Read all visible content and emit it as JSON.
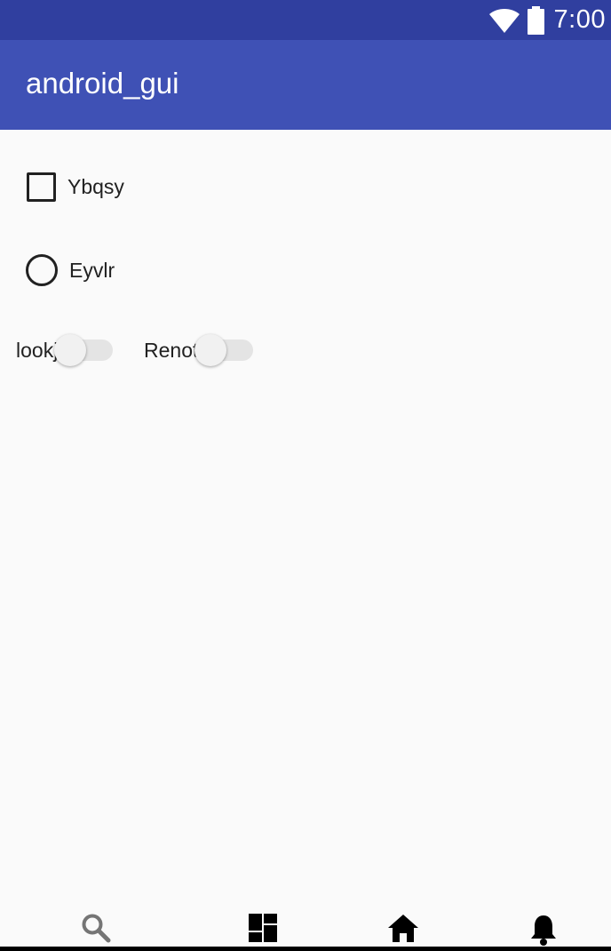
{
  "status_bar": {
    "time": "7:00",
    "icons": [
      "wifi-icon",
      "battery-icon"
    ],
    "color": "#303f9f"
  },
  "app_bar": {
    "title": "android_gui",
    "color": "#3f51b5"
  },
  "content": {
    "checkbox": {
      "label": "Ybqsy",
      "checked": false
    },
    "radio": {
      "label": "Eyvlr",
      "selected": false
    },
    "switches": [
      {
        "label": "lookj",
        "on": false
      },
      {
        "label": "Renot",
        "on": false
      }
    ]
  },
  "bottom_nav": {
    "items": [
      {
        "icon": "search-icon",
        "color": "#757575"
      },
      {
        "icon": "dashboard-icon",
        "color": "#000000"
      },
      {
        "icon": "home-icon",
        "color": "#000000"
      },
      {
        "icon": "notification-bell-icon",
        "color": "#000000"
      }
    ]
  }
}
